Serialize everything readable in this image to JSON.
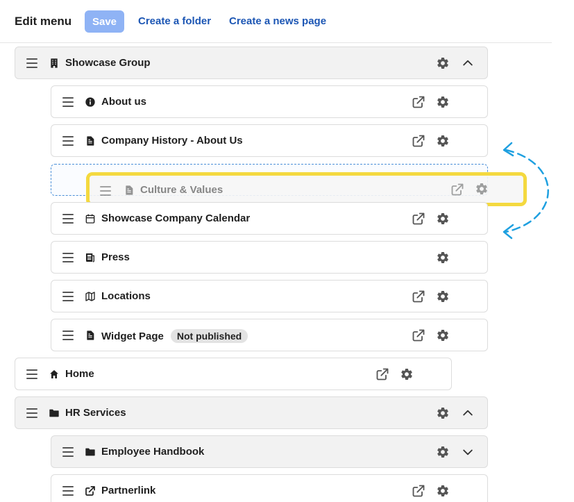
{
  "topbar": {
    "title": "Edit menu",
    "save_label": "Save",
    "create_folder_label": "Create a folder",
    "create_news_label": "Create a news page"
  },
  "menu": {
    "showcase_group": {
      "label": "Showcase Group",
      "icon": "building-icon"
    },
    "about_us": {
      "label": "About us",
      "icon": "info-icon"
    },
    "company_history": {
      "label": "Company History - About Us",
      "icon": "document-icon"
    },
    "dragged_item": {
      "label": "Culture & Values",
      "icon": "document-icon"
    },
    "calendar": {
      "label": "Showcase Company Calendar",
      "icon": "calendar-icon"
    },
    "press": {
      "label": "Press",
      "icon": "newspaper-icon"
    },
    "locations": {
      "label": "Locations",
      "icon": "map-icon"
    },
    "widget_page": {
      "label": "Widget Page",
      "badge": "Not published",
      "icon": "document-icon"
    },
    "home": {
      "label": "Home",
      "icon": "home-icon"
    },
    "hr_services": {
      "label": "HR Services",
      "icon": "folder-icon"
    },
    "employee_handbook": {
      "label": "Employee Handbook",
      "icon": "folder-icon"
    },
    "partnerlink": {
      "label": "Partnerlink",
      "icon": "external-link-icon"
    }
  },
  "colors": {
    "accent": "#1c56b4",
    "save_disabled": "#8fb3f5",
    "highlight": "#f4d93f",
    "drop_indicator": "#1fa0e0"
  }
}
